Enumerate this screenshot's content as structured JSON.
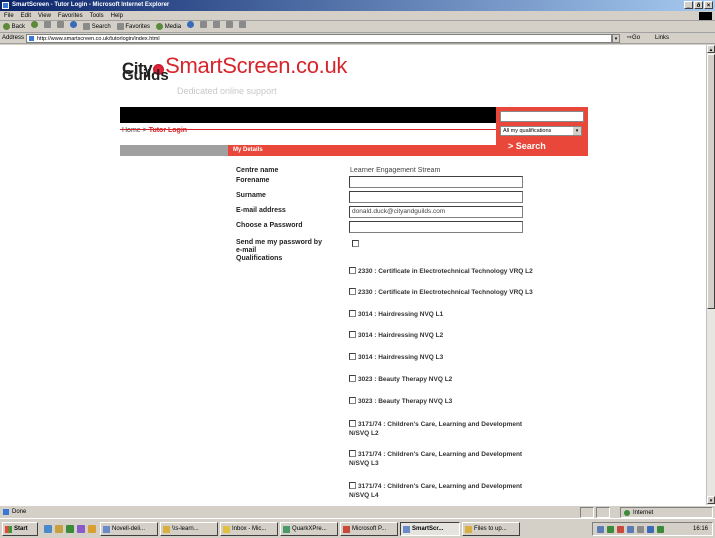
{
  "window": {
    "title": "SmartScreen - Tutor Login - Microsoft Internet Explorer",
    "controls": [
      "_",
      "ð",
      "×"
    ]
  },
  "menu": [
    "File",
    "Edit",
    "View",
    "Favorites",
    "Tools",
    "Help"
  ],
  "toolbar": {
    "back": "Back",
    "search": "Search",
    "favorites": "Favorites",
    "media": "Media"
  },
  "address": {
    "label": "Address",
    "url": "http://www.smartscreen.co.uk/tutorlogin/index.html",
    "go": "Go",
    "links": "Links"
  },
  "site": {
    "logo_city": "City",
    "logo_guilds": "Guilds",
    "logo_brand": "SmartScreen.co.uk",
    "tagline": "Dedicated online support",
    "breadcrumb_home": "Home",
    "breadcrumb_sep": ">",
    "breadcrumb_current": "Tutor Login",
    "search_select": "All my qualifications",
    "search_button": "> Search",
    "section_title": "My Details"
  },
  "form": {
    "centre_label": "Centre name",
    "centre_value": "Learner Engagement Stream",
    "forename_label": "Forename",
    "surname_label": "Surname",
    "email_label": "E-mail address",
    "email_value": "donald.duck@cityandguilds.com",
    "password_label": "Choose a Password",
    "send_password_label_1": "Send me my password by",
    "send_password_label_2": "e-mail",
    "qualifications_label": "Qualifications"
  },
  "qualifications": [
    "2330 : Certificate in Electrotechnical Technology VRQ L2",
    "2330 : Certificate in Electrotechnical Technology VRQ L3",
    "3014 : Hairdressing NVQ L1",
    "3014 : Hairdressing NVQ L2",
    "3014 : Hairdressing NVQ L3",
    "3023 : Beauty Therapy NVQ L2",
    "3023 : Beauty Therapy NVQ L3",
    "3171/74 : Children's Care, Learning and Development",
    "N/SVQ L2",
    "3171/74 : Children's Care, Learning and Development",
    "N/SVQ L3",
    "3171/74 : Children's Care, Learning and Development",
    "N/SVQ L4"
  ],
  "status": {
    "text": "Done",
    "zone": "Internet"
  },
  "taskbar": {
    "start": "Start",
    "buttons": [
      "Novell-deli...",
      "\\\\s-learn...",
      "Inbox - Mic...",
      "QuarkXPre...",
      "Microsoft P...",
      "SmartScr...",
      "Files to up..."
    ],
    "clock": "16:16"
  }
}
